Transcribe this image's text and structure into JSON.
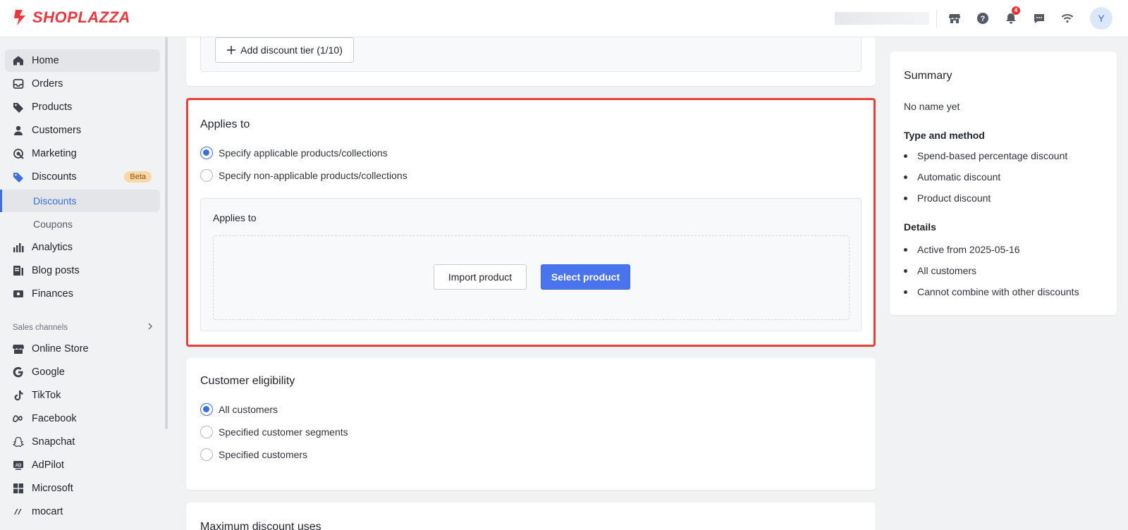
{
  "brand": {
    "name": "SHOPLAZZA",
    "color": "#e8383d"
  },
  "topbar": {
    "notification_count": "4",
    "avatar_initial": "Y",
    "icons": [
      "store-icon",
      "help-icon",
      "bell-icon",
      "message-icon",
      "wifi-icon"
    ]
  },
  "sidebar": {
    "items": [
      {
        "label": "Home",
        "icon": "home-icon"
      },
      {
        "label": "Orders",
        "icon": "inbox-icon"
      },
      {
        "label": "Products",
        "icon": "tag-icon"
      },
      {
        "label": "Customers",
        "icon": "user-icon"
      },
      {
        "label": "Marketing",
        "icon": "target-icon"
      },
      {
        "label": "Discounts",
        "icon": "discount-icon",
        "badge": "Beta"
      },
      {
        "label": "Analytics",
        "icon": "chart-icon"
      },
      {
        "label": "Blog posts",
        "icon": "blog-icon"
      },
      {
        "label": "Finances",
        "icon": "finance-icon"
      }
    ],
    "sub_items": [
      {
        "label": "Discounts",
        "active": true
      },
      {
        "label": "Coupons",
        "active": false
      }
    ],
    "section_label": "Sales channels",
    "channels": [
      {
        "label": "Online Store",
        "icon": "store-icon"
      },
      {
        "label": "Google",
        "icon": "google-icon"
      },
      {
        "label": "TikTok",
        "icon": "tiktok-icon"
      },
      {
        "label": "Facebook",
        "icon": "meta-icon"
      },
      {
        "label": "Snapchat",
        "icon": "snapchat-icon"
      },
      {
        "label": "AdPilot",
        "icon": "adpilot-icon"
      },
      {
        "label": "Microsoft",
        "icon": "microsoft-icon"
      },
      {
        "label": "mocart",
        "icon": "mocart-icon"
      }
    ]
  },
  "tiers": {
    "add_button": "Add discount tier (1/10)"
  },
  "applies_to": {
    "title": "Applies to",
    "options": [
      {
        "label": "Specify applicable products/collections",
        "selected": true
      },
      {
        "label": "Specify non-applicable products/collections",
        "selected": false
      }
    ],
    "inner_title": "Applies to",
    "import_button": "Import product",
    "select_button": "Select product"
  },
  "eligibility": {
    "title": "Customer eligibility",
    "options": [
      {
        "label": "All customers",
        "selected": true
      },
      {
        "label": "Specified customer segments",
        "selected": false
      },
      {
        "label": "Specified customers",
        "selected": false
      }
    ]
  },
  "max_uses": {
    "title": "Maximum discount uses"
  },
  "summary": {
    "title": "Summary",
    "name": "No name yet",
    "type_heading": "Type and method",
    "type_items": [
      "Spend-based percentage discount",
      "Automatic discount",
      "Product discount"
    ],
    "details_heading": "Details",
    "detail_items": [
      "Active from 2025-05-16",
      "All customers",
      "Cannot combine with other discounts"
    ]
  },
  "colors": {
    "accent": "#4a73ee",
    "highlight_border": "#e8433a",
    "beta_bg": "#fad7a8"
  }
}
